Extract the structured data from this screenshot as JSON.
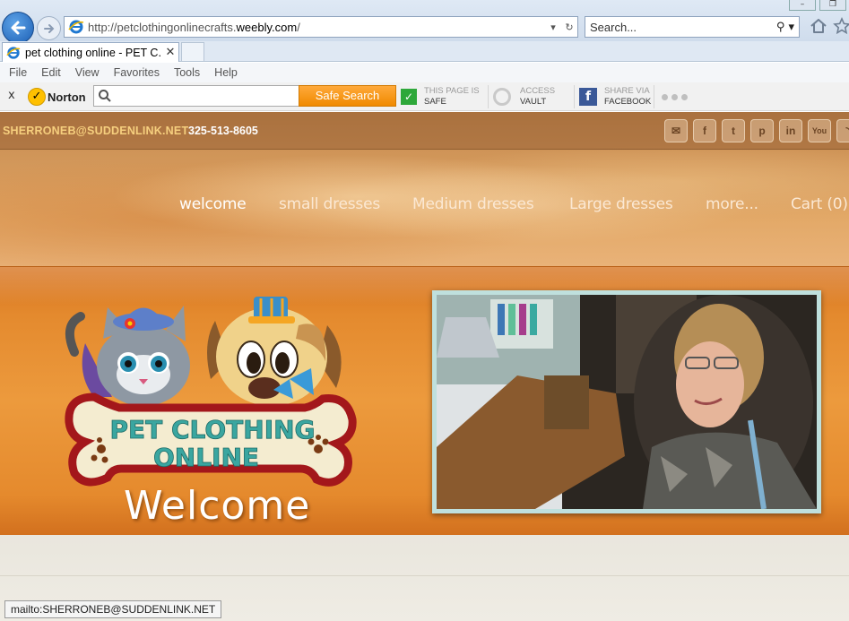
{
  "browser": {
    "url_prefix": "http://petclothingonlinecrafts.",
    "url_domain": "weebly.com",
    "url_suffix": "/",
    "search_placeholder": "Search...",
    "tab_title": "pet clothing online - PET C...",
    "tab_close": "✕",
    "menu": [
      "File",
      "Edit",
      "View",
      "Favorites",
      "Tools",
      "Help"
    ],
    "status_text": "mailto:SHERRONEB@SUDDENLINK.NET"
  },
  "norton": {
    "close": "x",
    "brand": "Norton",
    "search_button": "Safe Search",
    "items": [
      {
        "top": "THIS PAGE IS",
        "bottom": "SAFE"
      },
      {
        "top": "ACCESS",
        "bottom": "VAULT"
      },
      {
        "top": "SHARE VIA",
        "bottom": "FACEBOOK"
      }
    ]
  },
  "site": {
    "email": "SHERRONEB@SUDDENLINK.NET",
    "phone": "325-513-8605",
    "social": [
      "mail-icon",
      "facebook-icon",
      "twitter-icon",
      "pinterest-icon",
      "linkedin-icon",
      "youtube-icon",
      "rss-icon"
    ],
    "nav": [
      "welcome",
      "small dresses",
      "Medium dresses",
      "Large dresses",
      "more...",
      "Cart (0)"
    ],
    "logo_line1": "PET CLOTHING",
    "logo_line2": "ONLINE",
    "welcome_heading": "Welcome"
  },
  "colors": {
    "accent_orange": "#e48a2e",
    "email_gold": "#f6cf7e",
    "photo_frame": "#bfe0dd",
    "logo_text_teal": "#3aa6a0"
  }
}
